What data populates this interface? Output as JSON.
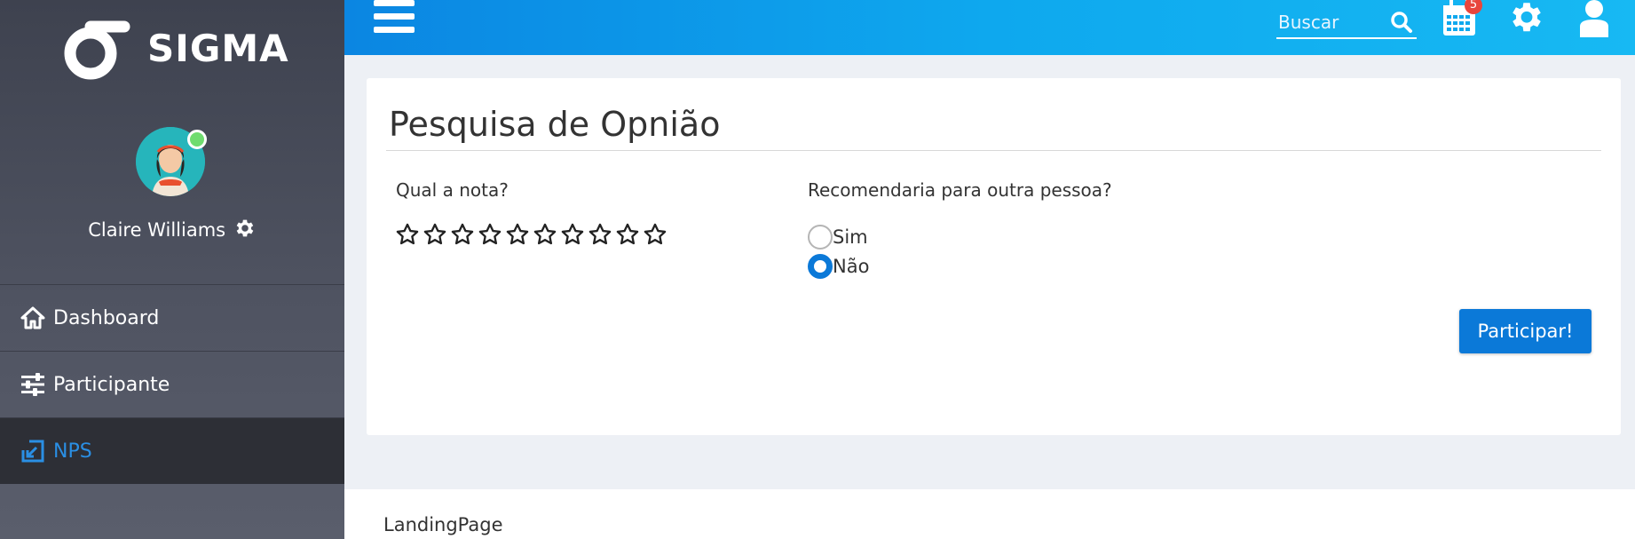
{
  "sidebar": {
    "logo_text": "SIGMA",
    "user_name": "Claire Williams",
    "items": [
      {
        "label": "Dashboard",
        "icon": "home-icon"
      },
      {
        "label": "Participante",
        "icon": "sliders-icon"
      },
      {
        "label": "NPS",
        "icon": "nps-icon",
        "active": true
      }
    ]
  },
  "topbar": {
    "search_placeholder": "Buscar",
    "calendar_badge": "5"
  },
  "card": {
    "title": "Pesquisa de Opnião",
    "rating_question": "Qual a nota?",
    "rating_max": 10,
    "rating_value": 0,
    "recommend_question": "Recomendaria para outra pessoa?",
    "options": [
      {
        "label": "Sim",
        "checked": false
      },
      {
        "label": "Não",
        "checked": true
      }
    ],
    "submit_label": "Participar!"
  },
  "footer": {
    "text": "LandingPage"
  },
  "colors": {
    "accent": "#0b79d8",
    "topbar": "#0ea8ee",
    "sidebar": "#4f5361",
    "badge": "#e8453c"
  }
}
